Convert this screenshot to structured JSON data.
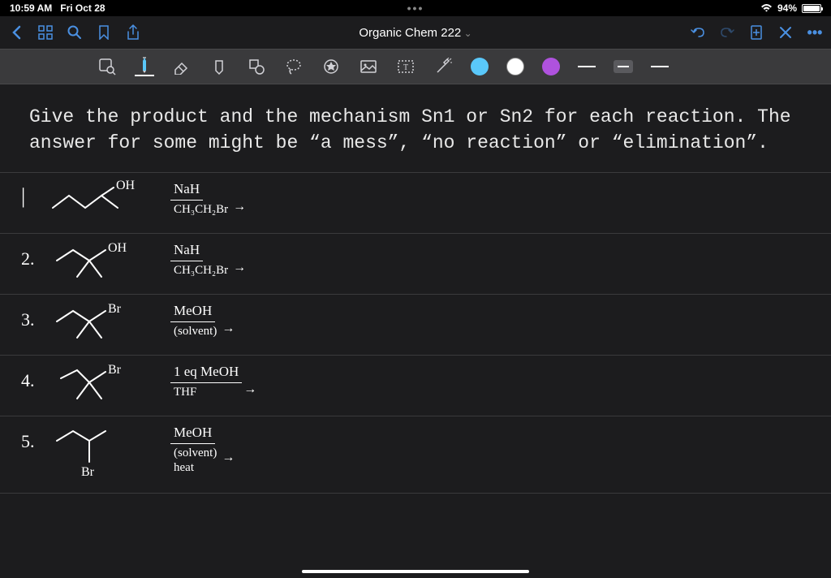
{
  "status": {
    "time": "10:59 AM",
    "date": "Fri Oct 28",
    "battery_pct": "94%",
    "wifi": "􀙇"
  },
  "nav": {
    "title": "Organic Chem 222"
  },
  "question": {
    "text": "Give the product and the mechanism Sn1 or Sn2 for each reaction. The answer for some might be “a mess”, “no reaction” or “elimination”."
  },
  "problems": [
    {
      "num_display": "|",
      "num_class": "num one",
      "substrate_label_parts": [
        "OH"
      ],
      "substrate_type": "primary",
      "reagent_top": "NaH",
      "reagent_bottom": "CH₃CH₂Br"
    },
    {
      "num_display": "2.",
      "num_class": "num",
      "substrate_label_parts": [
        "OH"
      ],
      "substrate_type": "tertiary",
      "reagent_top": "NaH",
      "reagent_bottom": "CH₃CH₂Br"
    },
    {
      "num_display": "3.",
      "num_class": "num",
      "substrate_label_parts": [
        "Br"
      ],
      "substrate_type": "tertiary",
      "reagent_top": "MeOH",
      "reagent_bottom": "(solvent)"
    },
    {
      "num_display": "4.",
      "num_class": "num",
      "substrate_label_parts": [
        "Br"
      ],
      "substrate_type": "tertiary",
      "reagent_top": "1 eq MeOH",
      "reagent_bottom": "THF"
    },
    {
      "num_display": "5.",
      "num_class": "num",
      "substrate_label_parts": [
        "Br"
      ],
      "substrate_type": "secondary_below",
      "reagent_top": "MeOH",
      "reagent_bottom": "(solvent)\nheat"
    }
  ],
  "colors": {
    "accent": "#4a90e2",
    "swatch1": "#5ac8fa",
    "swatch2": "#ffffff",
    "swatch3": "#af52de"
  }
}
